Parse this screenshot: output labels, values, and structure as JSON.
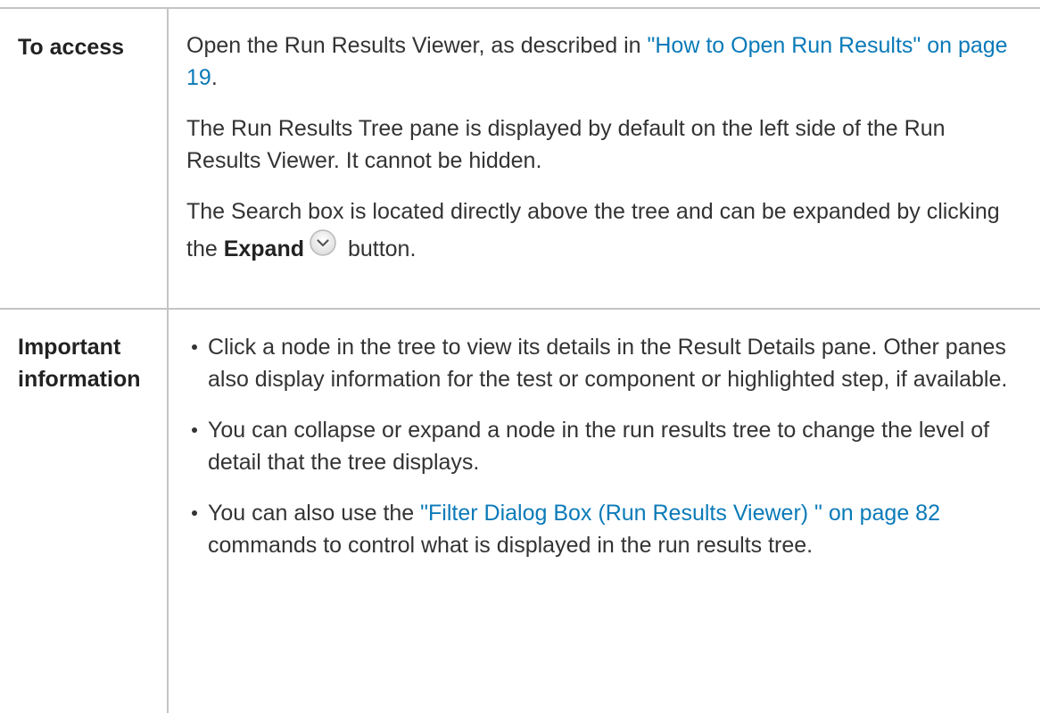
{
  "access": {
    "label": "To access",
    "p1_text_before": "Open the Run Results Viewer, as described in ",
    "p1_link": "\"How to Open Run Results\" on page 19",
    "p1_text_after": ".",
    "p2": "The Run Results Tree pane is displayed by default on the left side of the Run Results Viewer. It cannot be hidden.",
    "p3_text_before": "The Search box is located directly above the tree and can be expanded by clicking the ",
    "p3_bold": "Expand",
    "p3_icon": "expand-icon",
    "p3_text_after": " button."
  },
  "info": {
    "label": "Important information",
    "bullet1": "Click a node in the tree to view its details in the Result Details pane. Other panes also display information for the test or component or highlighted step, if available.",
    "bullet2": "You can collapse or expand a node in the run results tree to change the level of detail that the tree displays.",
    "bullet3_text_before": "You can also use the ",
    "bullet3_link": "\"Filter Dialog Box (Run Results Viewer) \" on page 82",
    "bullet3_text_after": " commands to control what is displayed in the run results tree."
  },
  "colors": {
    "link": "#0a7ab8",
    "text": "#333333",
    "border": "#c4c4c4"
  }
}
